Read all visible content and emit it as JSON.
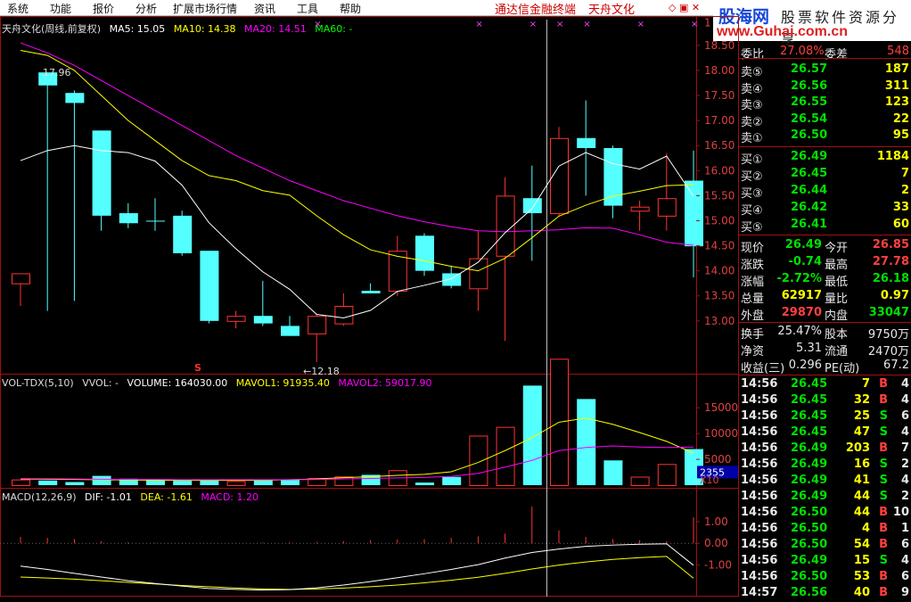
{
  "menu": [
    "系统",
    "功能",
    "报价",
    "分析",
    "扩展市场行情",
    "资讯",
    "工具",
    "帮助"
  ],
  "brand": "通达信金融终端",
  "stock_name": "天舟文化",
  "window_controls": "◇ ▣ ✕",
  "logo": {
    "cn": "股海网",
    "slogan": "股票软件资源分享",
    "url": "www.Guhai.com.cn"
  },
  "legend_main": {
    "title": "天舟文化(周线,前复权)",
    "ma5": "MA5: 15.05",
    "ma10": "MA10: 14.38",
    "ma20": "MA20: 14.51",
    "ma60": "MA60: -"
  },
  "legend_vol": {
    "title": "VOL-TDX(5,10)",
    "vvol": "VVOL: -",
    "volume": "VOLUME: 164030.00",
    "mavol1": "MAVOL1: 91935.40",
    "mavol2": "MAVOL2: 59017.90"
  },
  "legend_macd": {
    "title": "MACD(12,26,9)",
    "dif": "DIF: -1.01",
    "dea": "DEA: -1.61",
    "macd": "MACD: 1.20"
  },
  "annotations": {
    "high": "17.96",
    "low": "←12.18",
    "marker": "S"
  },
  "axis_labels": {
    "price": [
      "18.50",
      "18.00",
      "17.50",
      "17.00",
      "16.50",
      "16.00",
      "15.50",
      "15.00",
      "14.50",
      "14.00",
      "13.50",
      "13.00"
    ],
    "price_top": "1",
    "vol": [
      "15000",
      "10000",
      "5000"
    ],
    "vol_box": "2355",
    "vol_unit": "X10",
    "macd": [
      "1.00",
      "0.00",
      "-1.00"
    ]
  },
  "colors": {
    "up": "#ff3232",
    "down": "#54ffff",
    "ma5": "#ffffff",
    "ma10": "#ffff00",
    "ma20": "#ff00ff",
    "ma60": "#00ff00",
    "border": "#a01010"
  },
  "chart_data": {
    "type": "candlestick",
    "candles": [
      {
        "o": 13.75,
        "h": 13.95,
        "l": 13.3,
        "c": 13.95
      },
      {
        "o": 17.96,
        "h": 17.96,
        "l": 13.2,
        "c": 17.7
      },
      {
        "o": 17.55,
        "h": 17.6,
        "l": 13.4,
        "c": 17.35
      },
      {
        "o": 16.8,
        "h": 16.8,
        "l": 14.8,
        "c": 15.1
      },
      {
        "o": 15.15,
        "h": 15.35,
        "l": 14.85,
        "c": 14.95
      },
      {
        "o": 15.0,
        "h": 15.45,
        "l": 14.8,
        "c": 14.99
      },
      {
        "o": 15.1,
        "h": 15.2,
        "l": 14.3,
        "c": 14.35
      },
      {
        "o": 14.4,
        "h": 14.4,
        "l": 12.95,
        "c": 13.0
      },
      {
        "o": 13.0,
        "h": 13.2,
        "l": 12.85,
        "c": 13.1
      },
      {
        "o": 13.1,
        "h": 13.8,
        "l": 12.9,
        "c": 12.95
      },
      {
        "o": 12.9,
        "h": 13.1,
        "l": 12.7,
        "c": 12.7
      },
      {
        "o": 12.75,
        "h": 13.15,
        "l": 12.18,
        "c": 13.1
      },
      {
        "o": 12.95,
        "h": 13.55,
        "l": 12.9,
        "c": 13.3
      },
      {
        "o": 13.6,
        "h": 13.75,
        "l": 13.55,
        "c": 13.55
      },
      {
        "o": 13.6,
        "h": 14.7,
        "l": 13.5,
        "c": 14.4
      },
      {
        "o": 14.7,
        "h": 14.75,
        "l": 13.9,
        "c": 14.0
      },
      {
        "o": 13.95,
        "h": 14.1,
        "l": 13.65,
        "c": 13.7
      },
      {
        "o": 13.65,
        "h": 14.8,
        "l": 13.2,
        "c": 14.25
      },
      {
        "o": 14.3,
        "h": 15.87,
        "l": 12.6,
        "c": 15.5
      },
      {
        "o": 15.45,
        "h": 16.1,
        "l": 14.2,
        "c": 15.15
      },
      {
        "o": 15.15,
        "h": 16.87,
        "l": 15.1,
        "c": 16.65
      },
      {
        "o": 16.65,
        "h": 17.4,
        "l": 15.5,
        "c": 16.45
      },
      {
        "o": 16.45,
        "h": 16.5,
        "l": 15.05,
        "c": 15.3
      },
      {
        "o": 15.2,
        "h": 15.4,
        "l": 14.8,
        "c": 15.28
      },
      {
        "o": 15.1,
        "h": 16.35,
        "l": 14.8,
        "c": 15.45
      },
      {
        "o": 15.8,
        "h": 16.4,
        "l": 13.87,
        "c": 14.49
      }
    ],
    "ma5": [
      null,
      null,
      null,
      null,
      16.36,
      16.19,
      15.71,
      14.96,
      14.44,
      13.98,
      13.63,
      13.13,
      13.06,
      13.21,
      13.59,
      13.71,
      13.84,
      14.17,
      14.76,
      15.24,
      16.09,
      16.36,
      16.14,
      16.03,
      16.29,
      15.49
    ],
    "ma10": [
      null,
      null,
      null,
      null,
      null,
      null,
      null,
      null,
      null,
      null,
      15.51,
      15.1,
      14.72,
      14.42,
      14.29,
      14.2,
      14.09,
      14.0,
      14.25,
      14.66,
      15.09,
      15.31,
      15.49,
      15.59,
      15.7,
      15.72
    ],
    "ma20": [
      null,
      null,
      null,
      null,
      null,
      null,
      null,
      null,
      null,
      null,
      null,
      null,
      null,
      null,
      null,
      null,
      null,
      null,
      null,
      14.8,
      14.82,
      14.86,
      14.85,
      14.72,
      14.57,
      14.51
    ],
    "vol": [
      1100,
      900,
      600,
      1800,
      1250,
      1150,
      1050,
      1000,
      800,
      1050,
      1100,
      1350,
      1700,
      2000,
      2900,
      500,
      1600,
      9600,
      11300,
      19300,
      24500,
      16700,
      4800,
      1650,
      4100,
      7000
    ],
    "mavol1": [
      1200,
      1150,
      1100,
      1050,
      1000,
      950,
      950,
      940,
      940,
      960,
      1050,
      1200,
      1450,
      1650,
      1900,
      2100,
      2600,
      4400,
      6700,
      9200,
      12200,
      13000,
      11800,
      10200,
      8500,
      6200
    ],
    "mavol2": [
      1300,
      1250,
      1200,
      1150,
      1100,
      1100,
      1050,
      1050,
      1050,
      1050,
      1050,
      1100,
      1200,
      1300,
      1400,
      1500,
      1700,
      2300,
      3500,
      4800,
      6700,
      7300,
      7600,
      7400,
      7300,
      7400
    ],
    "macd_dif": [
      -1.05,
      -1.2,
      -1.38,
      -1.55,
      -1.72,
      -1.85,
      -1.97,
      -2.08,
      -2.12,
      -2.15,
      -2.13,
      -2.05,
      -1.92,
      -1.76,
      -1.58,
      -1.4,
      -1.2,
      -0.98,
      -0.68,
      -0.42,
      -0.26,
      -0.14,
      -0.08,
      -0.04,
      -0.02,
      -1.01
    ],
    "macd_dea": [
      -1.55,
      -1.6,
      -1.65,
      -1.72,
      -1.8,
      -1.87,
      -1.94,
      -2.0,
      -2.06,
      -2.1,
      -2.12,
      -2.1,
      -2.06,
      -2.0,
      -1.92,
      -1.82,
      -1.7,
      -1.56,
      -1.38,
      -1.18,
      -1.0,
      -0.86,
      -0.74,
      -0.66,
      -0.6,
      -1.61
    ],
    "macd_hist": [
      0.3,
      0.25,
      0.2,
      0.1,
      0.05,
      0.03,
      0.02,
      0.01,
      0.02,
      0.04,
      0.05,
      0.06,
      0.1,
      0.15,
      0.18,
      0.2,
      0.25,
      0.32,
      0.45,
      1.7,
      0.6,
      0.3,
      0.2,
      0.15,
      0.1,
      1.2
    ]
  },
  "quote": {
    "weibi": {
      "label": "委比",
      "value": "27.08%",
      "label2": "委差",
      "value2": "548"
    },
    "asks": [
      {
        "label": "卖⑤",
        "price": "26.57",
        "vol": "187"
      },
      {
        "label": "卖④",
        "price": "26.56",
        "vol": "311"
      },
      {
        "label": "卖③",
        "price": "26.55",
        "vol": "123"
      },
      {
        "label": "卖②",
        "price": "26.54",
        "vol": "22"
      },
      {
        "label": "卖①",
        "price": "26.50",
        "vol": "95"
      }
    ],
    "bids": [
      {
        "label": "买①",
        "price": "26.49",
        "vol": "1184"
      },
      {
        "label": "买②",
        "price": "26.45",
        "vol": "7"
      },
      {
        "label": "买③",
        "price": "26.44",
        "vol": "2"
      },
      {
        "label": "买④",
        "price": "26.42",
        "vol": "33"
      },
      {
        "label": "买⑤",
        "price": "26.41",
        "vol": "60"
      }
    ],
    "stats1": [
      {
        "l1": "现价",
        "v1": "26.49",
        "l2": "今开",
        "v2": "26.85"
      },
      {
        "l1": "涨跌",
        "v1": "-0.74",
        "l2": "最高",
        "v2": "27.78"
      },
      {
        "l1": "涨幅",
        "v1": "-2.72%",
        "l2": "最低",
        "v2": "26.18"
      },
      {
        "l1": "总量",
        "v1": "62917",
        "l2": "量比",
        "v2": "0.97"
      },
      {
        "l1": "外盘",
        "v1": "29870",
        "l2": "内盘",
        "v2": "33047"
      }
    ],
    "stats2": [
      {
        "l1": "换手",
        "v1": "25.47%",
        "l2": "股本",
        "v2": "9750万"
      },
      {
        "l1": "净资",
        "v1": "5.31",
        "l2": "流通",
        "v2": "2470万"
      },
      {
        "l1": "收益(三)",
        "v1": "0.296",
        "l2": "PE(动)",
        "v2": "67.2"
      }
    ],
    "ticks": [
      {
        "t": "14:56",
        "p": "26.45",
        "v": "7",
        "s": "B",
        "n": "4"
      },
      {
        "t": "14:56",
        "p": "26.45",
        "v": "32",
        "s": "B",
        "n": "4"
      },
      {
        "t": "14:56",
        "p": "26.45",
        "v": "25",
        "s": "S",
        "n": "6"
      },
      {
        "t": "14:56",
        "p": "26.45",
        "v": "47",
        "s": "S",
        "n": "4"
      },
      {
        "t": "14:56",
        "p": "26.49",
        "v": "203",
        "s": "B",
        "n": "7"
      },
      {
        "t": "14:56",
        "p": "26.49",
        "v": "16",
        "s": "S",
        "n": "2"
      },
      {
        "t": "14:56",
        "p": "26.49",
        "v": "41",
        "s": "S",
        "n": "4"
      },
      {
        "t": "14:56",
        "p": "26.49",
        "v": "44",
        "s": "S",
        "n": "2"
      },
      {
        "t": "14:56",
        "p": "26.50",
        "v": "44",
        "s": "B",
        "n": "10"
      },
      {
        "t": "14:56",
        "p": "26.50",
        "v": "4",
        "s": "B",
        "n": "1"
      },
      {
        "t": "14:56",
        "p": "26.50",
        "v": "54",
        "s": "B",
        "n": "6"
      },
      {
        "t": "14:56",
        "p": "26.49",
        "v": "15",
        "s": "S",
        "n": "4"
      },
      {
        "t": "14:56",
        "p": "26.50",
        "v": "53",
        "s": "B",
        "n": "6"
      },
      {
        "t": "14:57",
        "p": "26.56",
        "v": "40",
        "s": "B",
        "n": "9"
      }
    ]
  }
}
